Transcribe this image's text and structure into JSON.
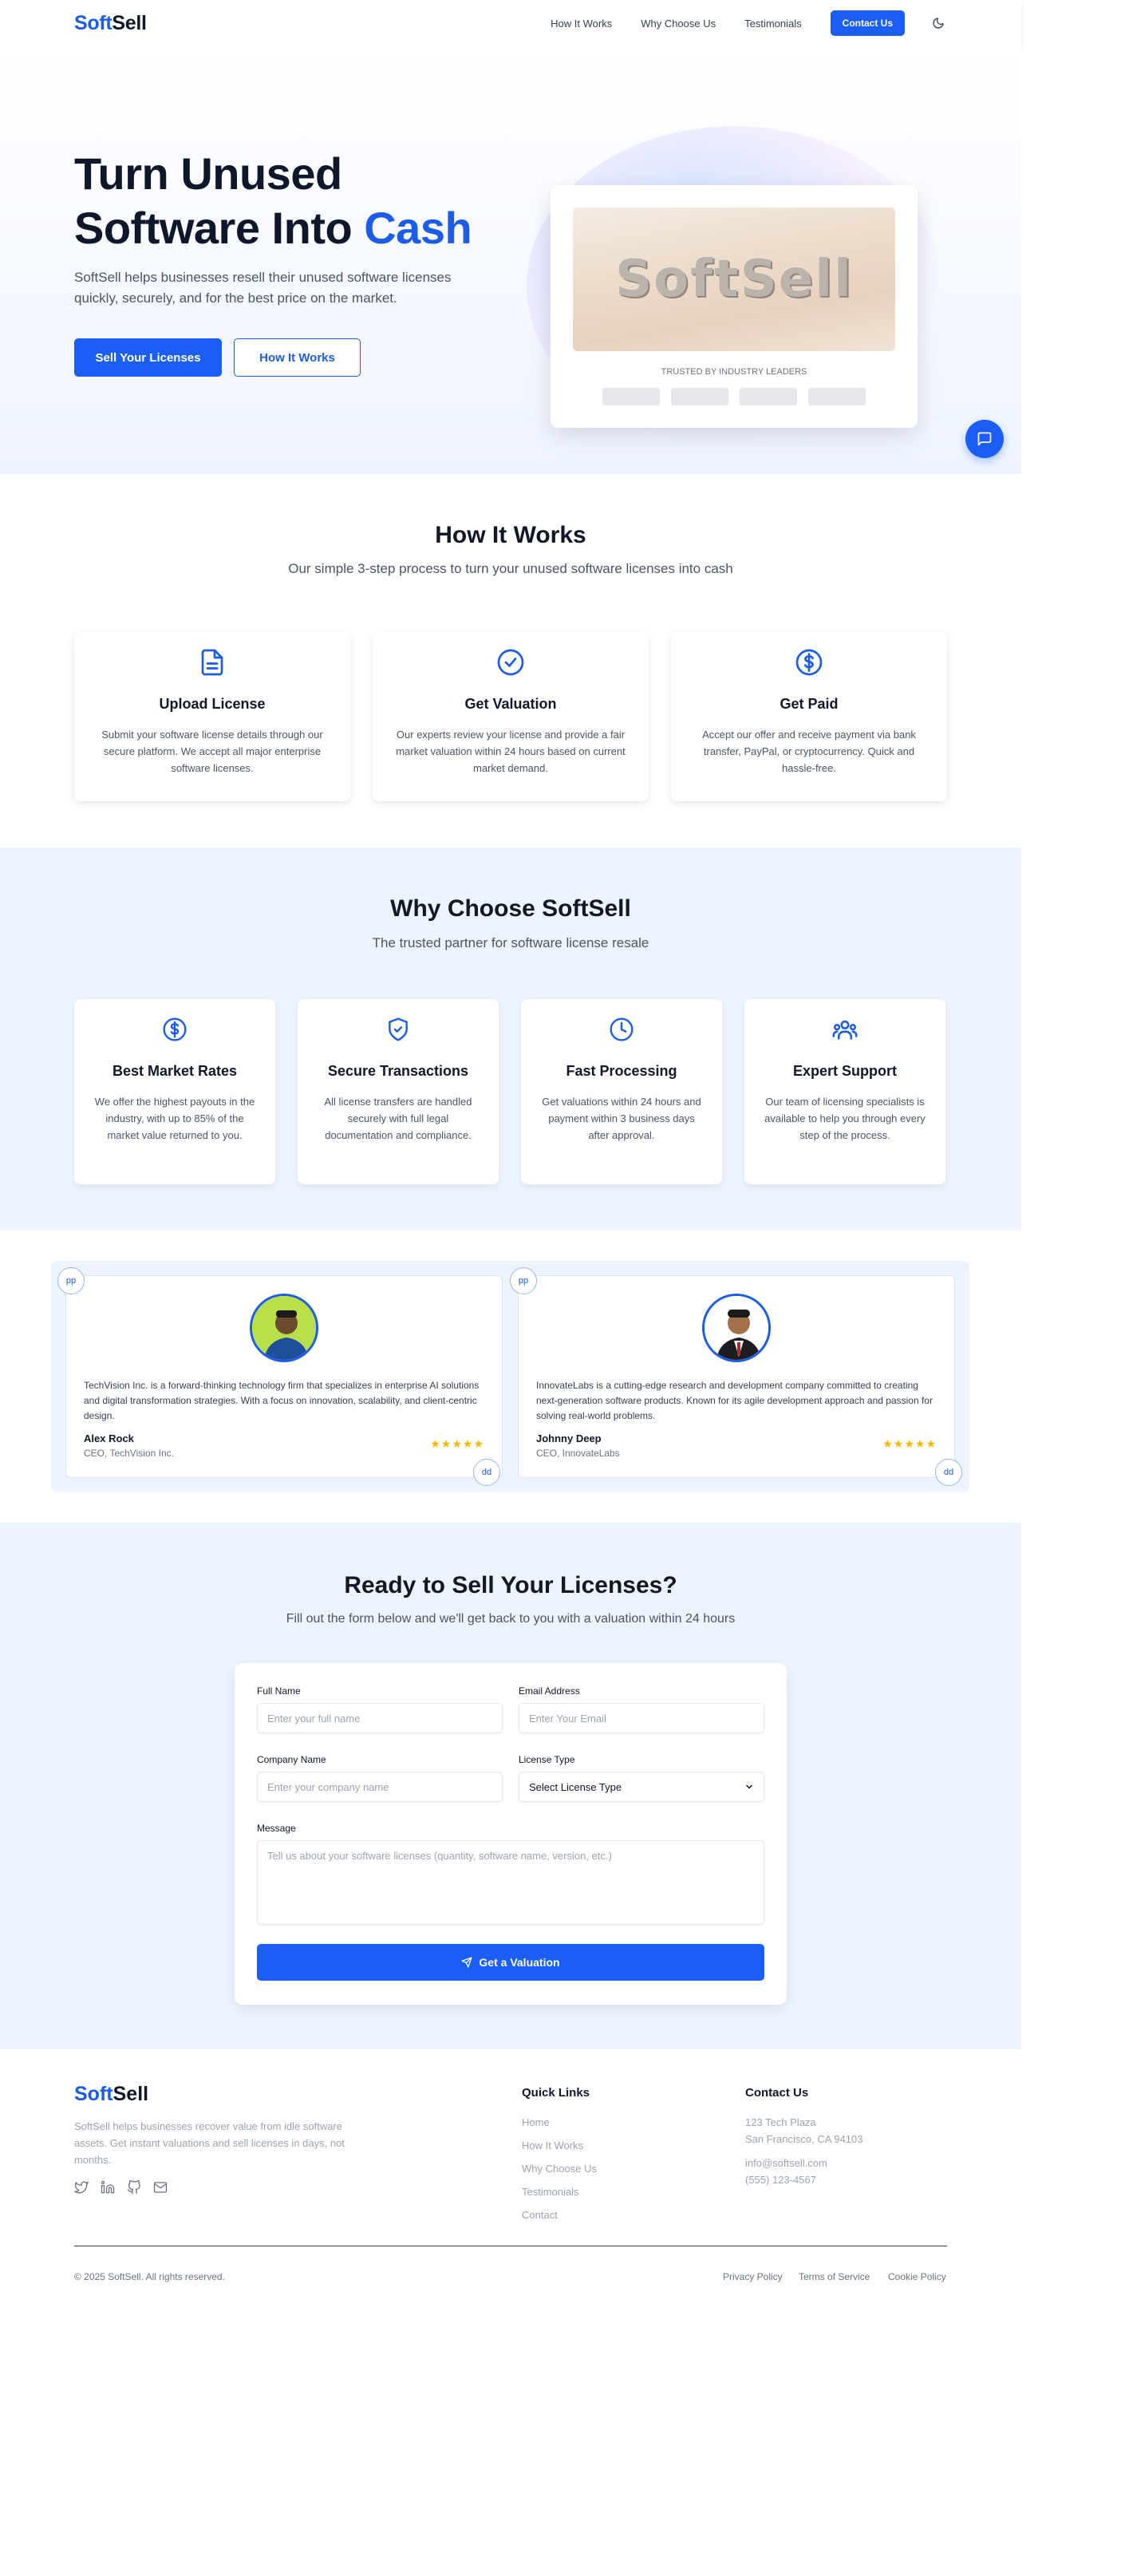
{
  "brand": {
    "part1": "Soft",
    "part2": "Sell"
  },
  "nav": {
    "links": [
      "How It Works",
      "Why Choose Us",
      "Testimonials"
    ],
    "cta": "Contact Us",
    "theme_icon": "moon-icon"
  },
  "hero": {
    "title_line1": "Turn Unused",
    "title_line2a": "Software Into ",
    "title_line2b": "Cash",
    "subtitle": "SoftSell helps businesses resell their unused software licenses quickly, securely, and for the best price on the market.",
    "primary_button": "Sell Your Licenses",
    "secondary_button": "How It Works",
    "image_text": "SoftSell",
    "trusted_label": "TRUSTED BY INDUSTRY LEADERS"
  },
  "how_it_works": {
    "title": "How It Works",
    "subtitle": "Our simple 3-step process to turn your unused software licenses into cash",
    "steps": [
      {
        "icon": "file-icon",
        "title": "Upload License",
        "text": "Submit your software license details through our secure platform. We accept all major enterprise software licenses."
      },
      {
        "icon": "check-circle-icon",
        "title": "Get Valuation",
        "text": "Our experts review your license and provide a fair market valuation within 24 hours based on current market demand."
      },
      {
        "icon": "dollar-circle-icon",
        "title": "Get Paid",
        "text": "Accept our offer and receive payment via bank transfer, PayPal, or cryptocurrency. Quick and hassle-free."
      }
    ]
  },
  "why_choose": {
    "title": "Why Choose SoftSell",
    "subtitle": "The trusted partner for software license resale",
    "items": [
      {
        "icon": "dollar-circle-icon",
        "title": "Best Market Rates",
        "text": "We offer the highest payouts in the industry, with up to 85% of the market value returned to you."
      },
      {
        "icon": "shield-check-icon",
        "title": "Secure Transactions",
        "text": "All license transfers are handled securely with full legal documentation and compliance."
      },
      {
        "icon": "clock-icon",
        "title": "Fast Processing",
        "text": "Get valuations within 24 hours and payment within 3 business days after approval."
      },
      {
        "icon": "users-icon",
        "title": "Expert Support",
        "text": "Our team of licensing specialists is available to help you through every step of the process."
      }
    ]
  },
  "testimonials": {
    "prev_label": "pp",
    "next_label": "dd",
    "items": [
      {
        "text": "TechVision Inc. is a forward-thinking technology firm that specializes in enterprise AI solutions and digital transformation strategies. With a focus on innovation, scalability, and client-centric design.",
        "name": "Alex Rock",
        "role": "CEO, TechVision Inc.",
        "stars": "★★★★★"
      },
      {
        "text": "InnovateLabs is a cutting-edge research and development company committed to creating next-generation software products. Known for its agile development approach and passion for solving real-world problems.",
        "name": "Johnny Deep",
        "role": "CEO, InnovateLabs",
        "stars": "★★★★★"
      }
    ]
  },
  "contact_form": {
    "title": "Ready to Sell Your Licenses?",
    "subtitle": "Fill out the form below and we'll get back to you with a valuation within 24 hours",
    "full_name_label": "Full Name",
    "full_name_placeholder": "Enter your full name",
    "email_label": "Email Address",
    "email_placeholder": "Enter Your Email",
    "company_label": "Company Name",
    "company_placeholder": "Enter your company name",
    "license_label": "License Type",
    "license_selected": "Select License Type",
    "message_label": "Message",
    "message_placeholder": "Tell us about your software licenses (quantity, software name, version, etc.)",
    "submit": "Get a Valuation"
  },
  "footer": {
    "description": "SoftSell helps businesses recover value from idle software assets. Get instant valuations and sell licenses in days, not months.",
    "quick_links_title": "Quick Links",
    "quick_links": [
      "Home",
      "How It Works",
      "Why Choose Us",
      "Testimonials",
      "Contact"
    ],
    "contact_title": "Contact Us",
    "address_line1": "123 Tech Plaza",
    "address_line2": "San Francisco, CA 94103",
    "email": "info@softsell.com",
    "phone": "(555) 123-4567",
    "copyright": "© 2025 SoftSell. All rights reserved.",
    "legal_links": [
      "Privacy Policy",
      "Terms of Service",
      "Cookie Policy"
    ],
    "social_icons": [
      "twitter-icon",
      "linkedin-icon",
      "github-icon",
      "mail-icon"
    ]
  },
  "colors": {
    "accent": "#1a5ef5",
    "brand_blue": "#1d5ce8",
    "section_bg": "#eef4ff",
    "star": "#f5b800"
  }
}
